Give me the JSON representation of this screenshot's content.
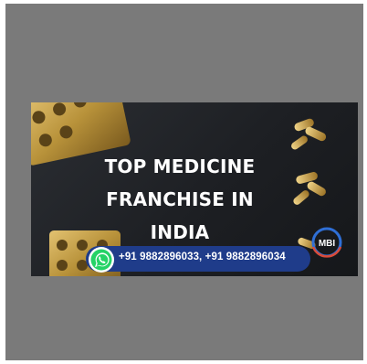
{
  "headline": {
    "line1": "TOP MEDICINE",
    "line2": "FRANCHISE IN",
    "line3": "INDIA"
  },
  "contact": {
    "icon": "whatsapp-icon",
    "phones": "+91 9882896033, +91 9882896034"
  },
  "logo": {
    "text": "MBI"
  },
  "colors": {
    "frame": "#7a7a7a",
    "banner_bg": "#1d1f23",
    "phone_bar": "#1f3c8a",
    "whatsapp": "#25d366",
    "gold": "#b8923a"
  }
}
